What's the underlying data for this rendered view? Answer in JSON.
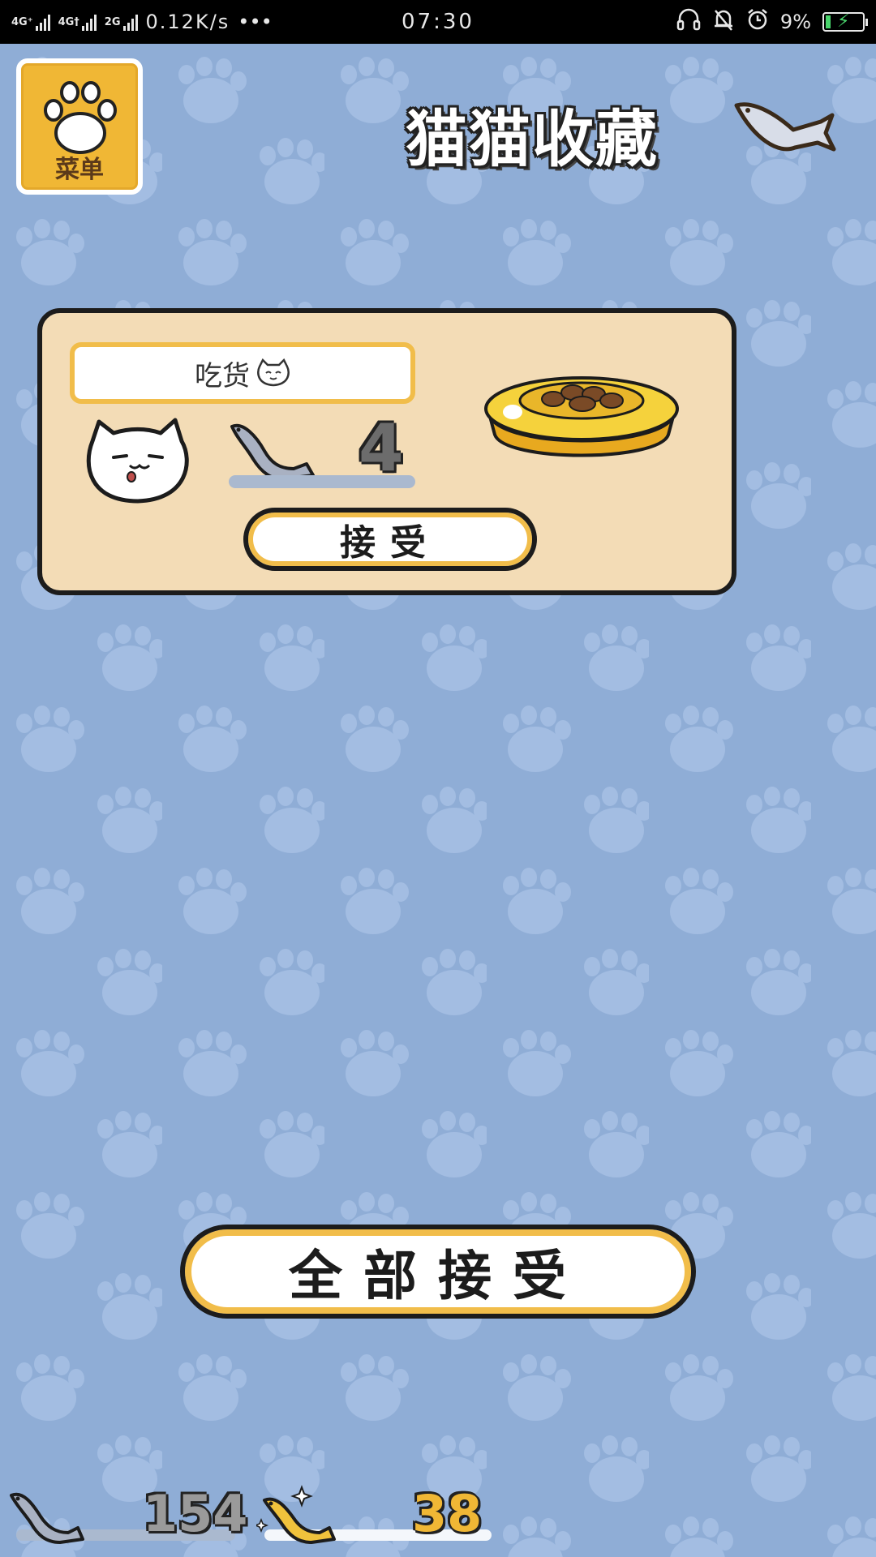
{
  "status_bar": {
    "network_1": "4G⁺",
    "network_2": "4G†",
    "network_3": "2G",
    "speed": "0.12K/s",
    "more": "•••",
    "time": "07:30",
    "battery": "9%"
  },
  "header": {
    "menu_label": "菜单",
    "title": "猫猫收藏"
  },
  "gift": {
    "cat_name": "吃货",
    "fish_count": "4",
    "accept_label": "接受"
  },
  "accept_all_label": "全部接受",
  "currency": {
    "silver_fish": "154",
    "gold_fish": "38"
  },
  "colors": {
    "background": "#8fadd6",
    "pattern": "#a3bde2",
    "card": "#f3dcb6",
    "accent_gold": "#f1bd4a",
    "outline": "#1c1c1c"
  }
}
